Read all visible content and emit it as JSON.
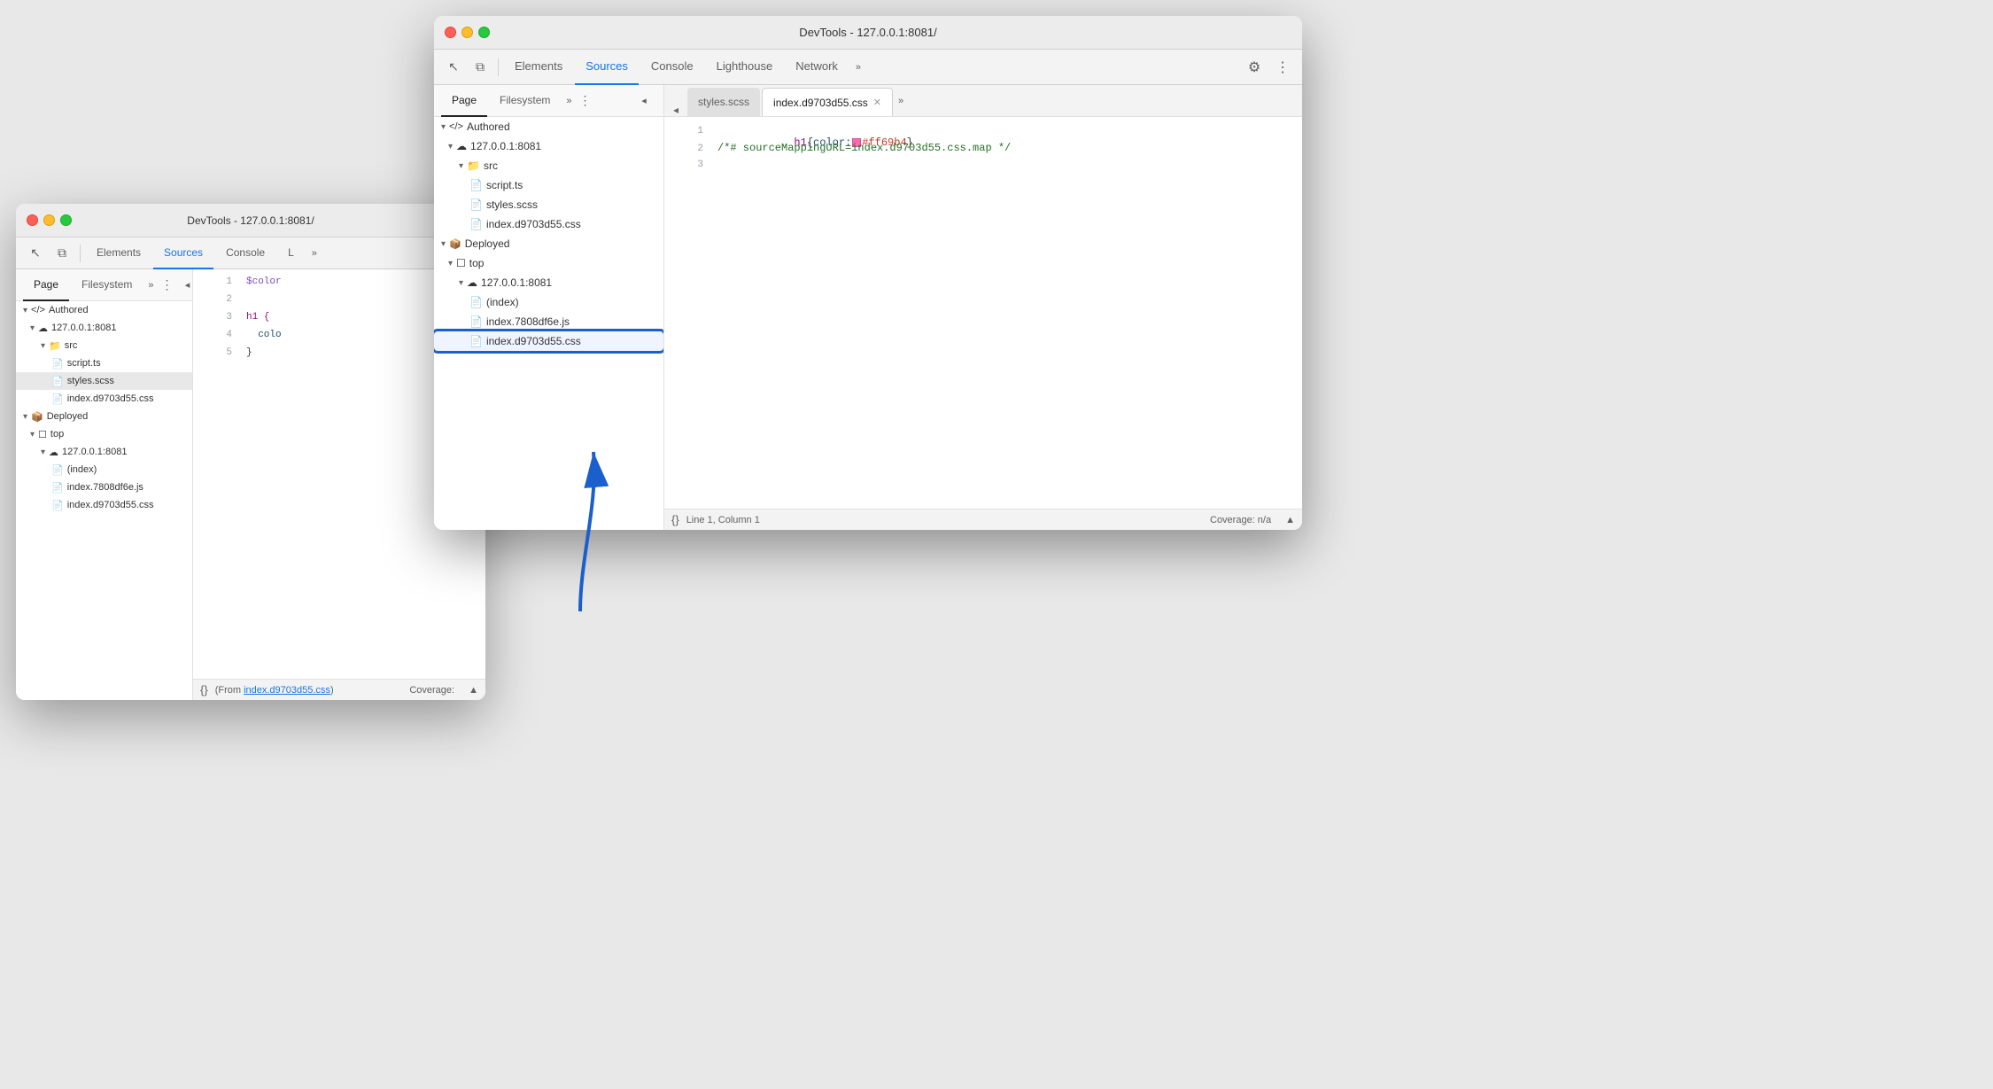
{
  "back_window": {
    "titlebar": "DevTools - 127.0.0.1:8081/",
    "tabs": [
      "Elements",
      "Sources",
      "Console",
      "L"
    ],
    "active_tab": "Sources",
    "sub_tabs": [
      "Page",
      "Filesystem"
    ],
    "active_sub_tab": "Page",
    "file_tab_open": "script.ts",
    "file_tree": [
      {
        "label": "◀/▶ Authored",
        "level": 0,
        "type": "section",
        "expanded": true
      },
      {
        "label": "☁ 127.0.0.1:8081",
        "level": 1,
        "type": "host",
        "expanded": true
      },
      {
        "label": "▼ src",
        "level": 2,
        "type": "folder",
        "expanded": true
      },
      {
        "label": "script.ts",
        "level": 3,
        "type": "ts"
      },
      {
        "label": "styles.scss",
        "level": 3,
        "type": "scss",
        "selected": true
      },
      {
        "label": "index.d9703d55.css",
        "level": 3,
        "type": "css"
      },
      {
        "label": "▼ Deployed",
        "level": 0,
        "type": "section",
        "expanded": true
      },
      {
        "label": "▼ top",
        "level": 1,
        "type": "folder",
        "expanded": true
      },
      {
        "label": "☁ 127.0.0.1:8081",
        "level": 2,
        "type": "host",
        "expanded": true
      },
      {
        "label": "(index)",
        "level": 3,
        "type": "generic"
      },
      {
        "label": "index.7808df6e.js",
        "level": 3,
        "type": "js"
      },
      {
        "label": "index.d9703d55.css",
        "level": 3,
        "type": "css"
      }
    ],
    "code_lines": [
      {
        "num": 1,
        "text": "$color"
      },
      {
        "num": 2,
        "text": ""
      },
      {
        "num": 3,
        "text": "h1 {"
      },
      {
        "num": 4,
        "text": "  colo"
      },
      {
        "num": 5,
        "text": "}"
      }
    ],
    "status": {
      "from_text": "(From ",
      "from_link": "index.d9703d55.css",
      "from_end": ")",
      "coverage": "Coverage:"
    }
  },
  "front_window": {
    "titlebar": "DevTools - 127.0.0.1:8081/",
    "tabs": [
      "Elements",
      "Sources",
      "Console",
      "Lighthouse",
      "Network"
    ],
    "active_tab": "Sources",
    "sub_tabs": [
      "Page",
      "Filesystem"
    ],
    "active_sub_tab": "Page",
    "file_tabs": [
      "styles.scss",
      "index.d9703d55.css"
    ],
    "active_file_tab": "index.d9703d55.css",
    "file_tree": [
      {
        "label": "◀/▶ Authored",
        "level": 0,
        "type": "section",
        "expanded": true
      },
      {
        "label": "☁ 127.0.0.1:8081",
        "level": 1,
        "type": "host",
        "expanded": true
      },
      {
        "label": "▼ src",
        "level": 2,
        "type": "folder",
        "expanded": true
      },
      {
        "label": "script.ts",
        "level": 3,
        "type": "ts"
      },
      {
        "label": "styles.scss",
        "level": 3,
        "type": "scss"
      },
      {
        "label": "index.d9703d55.css",
        "level": 3,
        "type": "css"
      },
      {
        "label": "▼ Deployed",
        "level": 0,
        "type": "section",
        "expanded": true
      },
      {
        "label": "▼ top",
        "level": 1,
        "type": "folder",
        "expanded": true
      },
      {
        "label": "☁ 127.0.0.1:8081",
        "level": 2,
        "type": "host",
        "expanded": true
      },
      {
        "label": "(index)",
        "level": 3,
        "type": "generic"
      },
      {
        "label": "index.7808df6e.js",
        "level": 3,
        "type": "js"
      },
      {
        "label": "index.d9703d55.css",
        "level": 3,
        "type": "css",
        "highlighted": true
      }
    ],
    "code_lines": [
      {
        "num": 1,
        "text_parts": [
          {
            "t": "h1{color:",
            "cls": "css-selector"
          },
          {
            "t": "swatch",
            "cls": "swatch"
          },
          {
            "t": "#ff69b4",
            "cls": "css-value-color"
          },
          {
            "t": "}",
            "cls": "css-punc"
          }
        ]
      },
      {
        "num": 2,
        "text_parts": [
          {
            "t": "/*# sourceMappingURL=index.d9703d55.css.map */",
            "cls": "css-comment"
          }
        ]
      },
      {
        "num": 3,
        "text_parts": []
      }
    ],
    "status": {
      "line_col": "Line 1, Column 1",
      "coverage": "Coverage: n/a"
    }
  },
  "icons": {
    "arrow_icon": "→",
    "chevron_right": "›",
    "chevron_down": "▾",
    "more_tabs": "»",
    "settings": "⚙",
    "dots": "⋮",
    "cursor_icon": "↖",
    "layers_icon": "⧉",
    "format_icon": "{}",
    "back_button": "◂",
    "scroll_icon": "▲"
  }
}
